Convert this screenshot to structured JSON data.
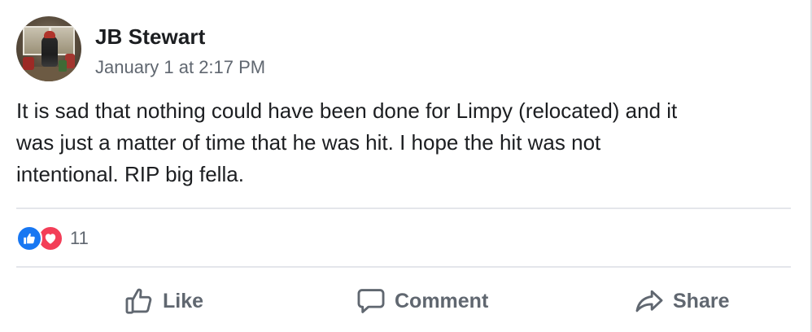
{
  "post": {
    "author": "JB Stewart",
    "timestamp": "January 1 at 2:17 PM",
    "body_lines": [
      "It is sad that nothing could have been done for Limpy (relocated) and it",
      "was just a matter of time that he was hit. I hope the hit was not",
      "intentional. RIP big fella."
    ]
  },
  "reactions": {
    "icons": [
      "like-reaction-icon",
      "love-reaction-icon"
    ],
    "count": "11"
  },
  "actions": {
    "like_label": "Like",
    "comment_label": "Comment",
    "share_label": "Share"
  },
  "colors": {
    "like_blue": "#1877f2",
    "love_red": "#f33e58",
    "secondary_text": "#606770",
    "primary_text": "#1c1e21",
    "divider": "#e4e6eb"
  }
}
